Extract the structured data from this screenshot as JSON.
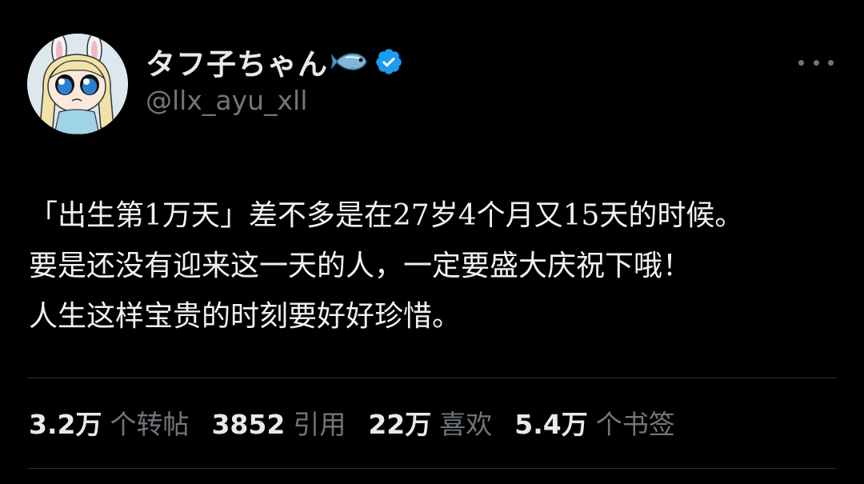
{
  "author": {
    "display_name": "タフ子ちゃん",
    "handle": "@llx_ayu_xll",
    "emoji": "fish-icon",
    "verified": true
  },
  "tweet": {
    "lines": [
      "「出生第1万天」差不多是在27岁4个月又15天的时候。",
      "要是还没有迎来这一天的人，一定要盛大庆祝下哦！",
      "人生这样宝贵的时刻要好好珍惜。"
    ]
  },
  "stats": [
    {
      "count": "3.2万",
      "label": "个转帖"
    },
    {
      "count": "3852",
      "label": "引用"
    },
    {
      "count": "22万",
      "label": "喜欢"
    },
    {
      "count": "5.4万",
      "label": "个书签"
    }
  ],
  "colors": {
    "background": "#000000",
    "text_primary": "#e7e9ea",
    "text_secondary": "#71767b",
    "verified": "#1d9bf0",
    "divider": "#2f3336"
  }
}
